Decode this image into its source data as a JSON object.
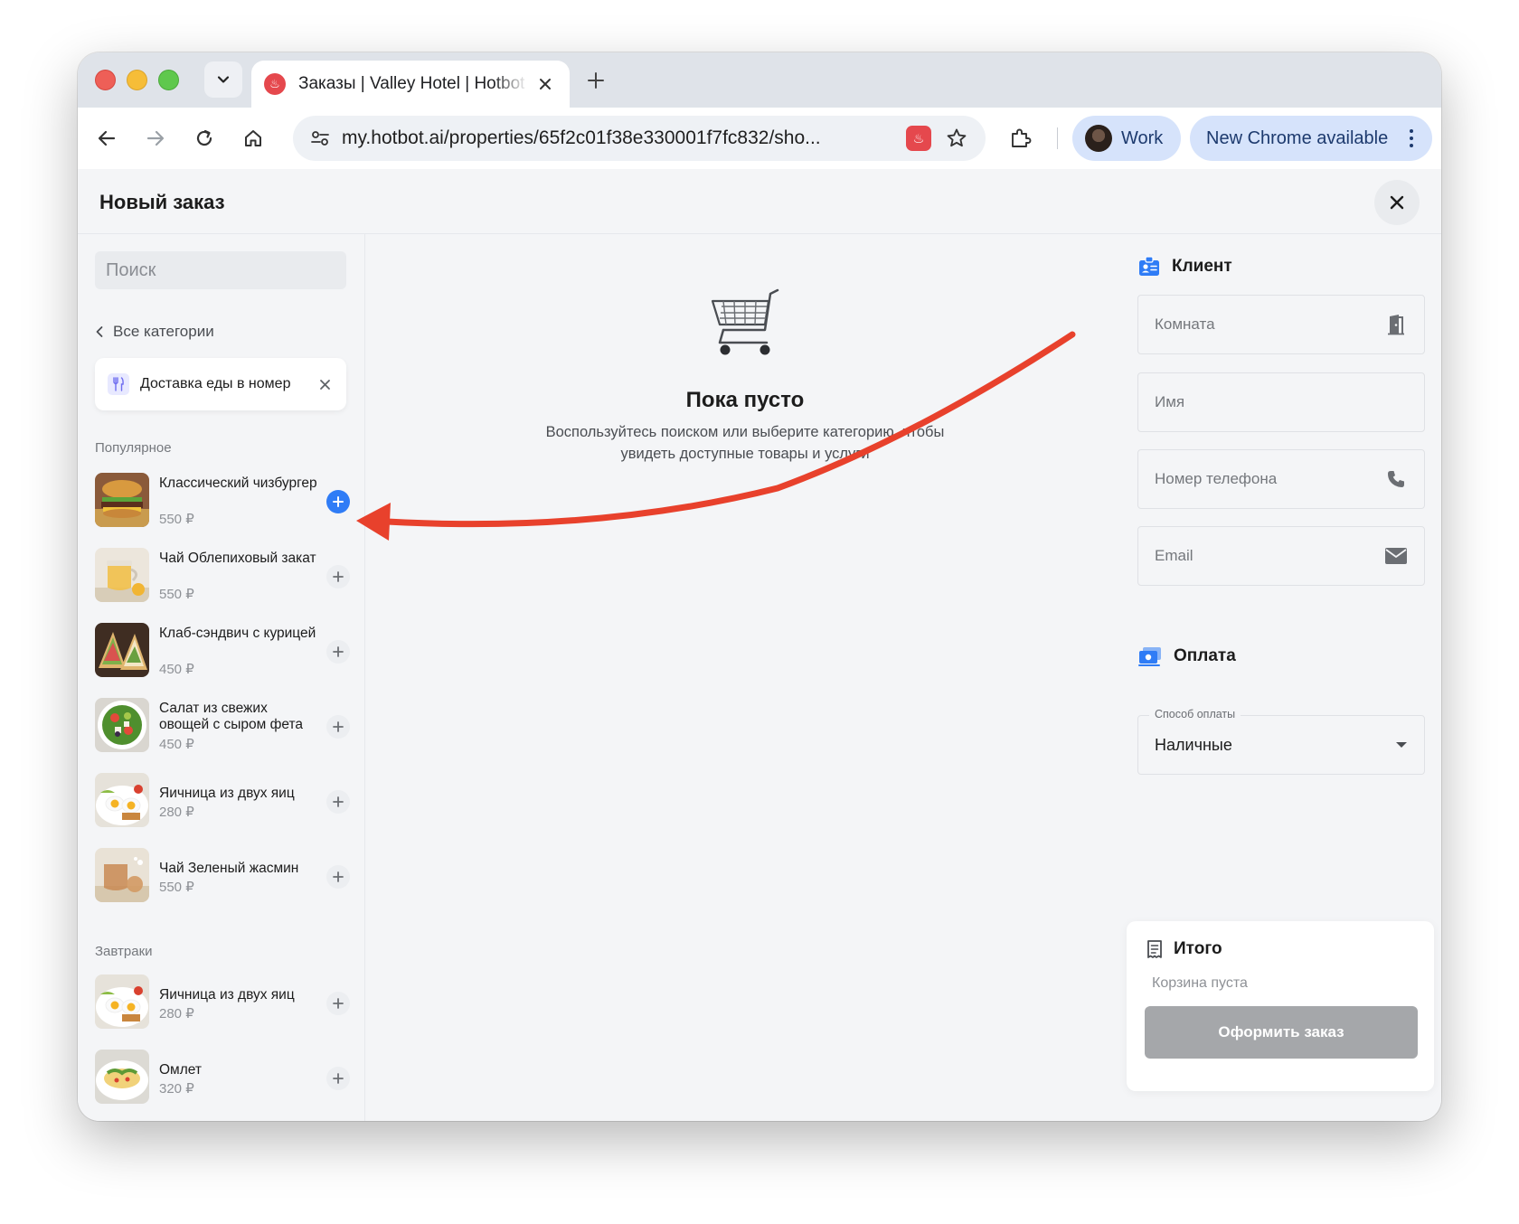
{
  "browser": {
    "tab_title": "Заказы | Valley Hotel | Hotbot",
    "url": "my.hotbot.ai/properties/65f2c01f38e330001f7fc832/sho...",
    "profile_label": "Work",
    "update_label": "New Chrome available"
  },
  "modal": {
    "title": "Новый заказ"
  },
  "catalog": {
    "search_placeholder": "Поиск",
    "back_label": "Все категории",
    "selected_category": "Доставка еды в номер",
    "sections": [
      {
        "title": "Популярное",
        "items": [
          {
            "name": "Классический чизбургер",
            "price": "550 ₽"
          },
          {
            "name": "Чай Облепиховый закат",
            "price": "550 ₽"
          },
          {
            "name": "Клаб-сэндвич с курицей",
            "price": "450 ₽"
          },
          {
            "name": "Салат из свежих овощей с сыром фета",
            "price": "450 ₽"
          },
          {
            "name": "Яичница из двух яиц",
            "price": "280 ₽"
          },
          {
            "name": "Чай Зеленый жасмин",
            "price": "550 ₽"
          }
        ]
      },
      {
        "title": "Завтраки",
        "items": [
          {
            "name": "Яичница из двух яиц",
            "price": "280 ₽"
          },
          {
            "name": "Омлет",
            "price": "320 ₽"
          }
        ]
      }
    ]
  },
  "cart": {
    "empty_title": "Пока пусто",
    "empty_text": "Воспользуйтесь поиском или выберите категорию, чтобы увидеть доступные товары и услуги"
  },
  "client": {
    "title": "Клиент",
    "room_placeholder": "Комната",
    "name_placeholder": "Имя",
    "phone_placeholder": "Номер телефона",
    "email_placeholder": "Email"
  },
  "payment": {
    "title": "Оплата",
    "method_label": "Способ оплаты",
    "method_value": "Наличные"
  },
  "summary": {
    "title": "Итого",
    "empty_label": "Корзина пуста",
    "checkout_label": "Оформить заказ"
  },
  "colors": {
    "accent": "#2f7cf6",
    "annotation_arrow": "#e8412c",
    "checkout_disabled": "#a5a7aa"
  }
}
